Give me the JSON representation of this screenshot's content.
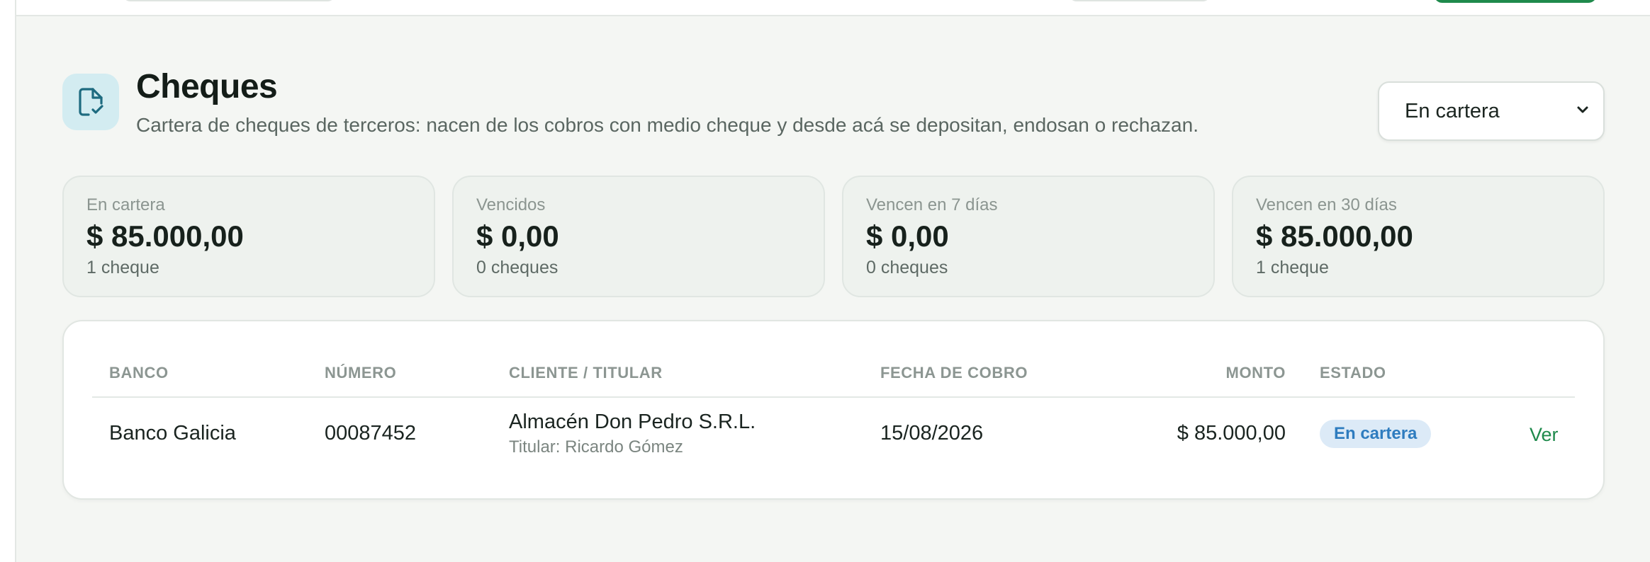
{
  "header": {
    "title": "Cheques",
    "subtitle": "Cartera de cheques de terceros: nacen de los cobros con medio cheque y desde acá se depositan, endosan o rechazan.",
    "filter": {
      "selected": "En cartera"
    }
  },
  "stats": [
    {
      "label": "En cartera",
      "value": "$ 85.000,00",
      "count": "1 cheque"
    },
    {
      "label": "Vencidos",
      "value": "$ 0,00",
      "count": "0 cheques"
    },
    {
      "label": "Vencen en 7 días",
      "value": "$ 0,00",
      "count": "0 cheques"
    },
    {
      "label": "Vencen en 30 días",
      "value": "$ 85.000,00",
      "count": "1 cheque"
    }
  ],
  "table": {
    "columns": {
      "banco": "BANCO",
      "numero": "NÚMERO",
      "cliente": "CLIENTE / TITULAR",
      "fecha": "FECHA DE COBRO",
      "monto": "MONTO",
      "estado": "ESTADO"
    },
    "rows": [
      {
        "banco": "Banco Galicia",
        "numero": "00087452",
        "cliente": "Almacén Don Pedro S.R.L.",
        "titular": "Titular: Ricardo Gómez",
        "fecha": "15/08/2026",
        "monto": "$ 85.000,00",
        "estado": "En cartera",
        "action": "Ver"
      }
    ]
  },
  "colors": {
    "accent_green": "#1f8a4c",
    "badge_bg": "#dceaf7",
    "badge_text": "#2e7cbf",
    "icon_tile": "#d3ecf1",
    "icon_stroke": "#1e6b80"
  },
  "icons": {
    "header": "document-check-icon",
    "select": "chevron-down-icon"
  }
}
